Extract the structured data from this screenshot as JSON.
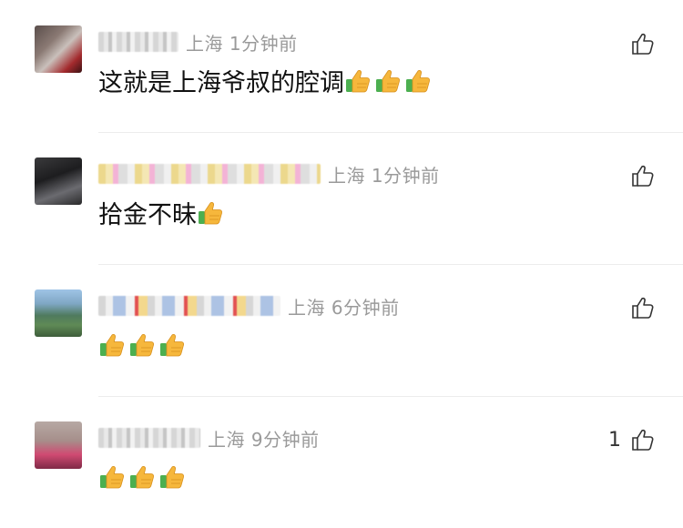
{
  "comments": [
    {
      "time": "上海 1分钟前",
      "text": "这就是上海爷叔的腔调",
      "thumbs": 3,
      "likes": ""
    },
    {
      "time": "上海 1分钟前",
      "text": "拾金不昧",
      "thumbs": 1,
      "likes": ""
    },
    {
      "time": "上海 6分钟前",
      "text": "",
      "thumbs": 3,
      "likes": ""
    },
    {
      "time": "上海 9分钟前",
      "text": "",
      "thumbs": 3,
      "likes": "1"
    }
  ],
  "icons": {
    "like": "thumbs-up-outline-icon",
    "emoji": "thumbs-up-emoji-icon"
  },
  "colors": {
    "timestamp": "#9a9a9a",
    "emoji_yellow": "#f6b73c",
    "emoji_green": "#4caf50"
  }
}
